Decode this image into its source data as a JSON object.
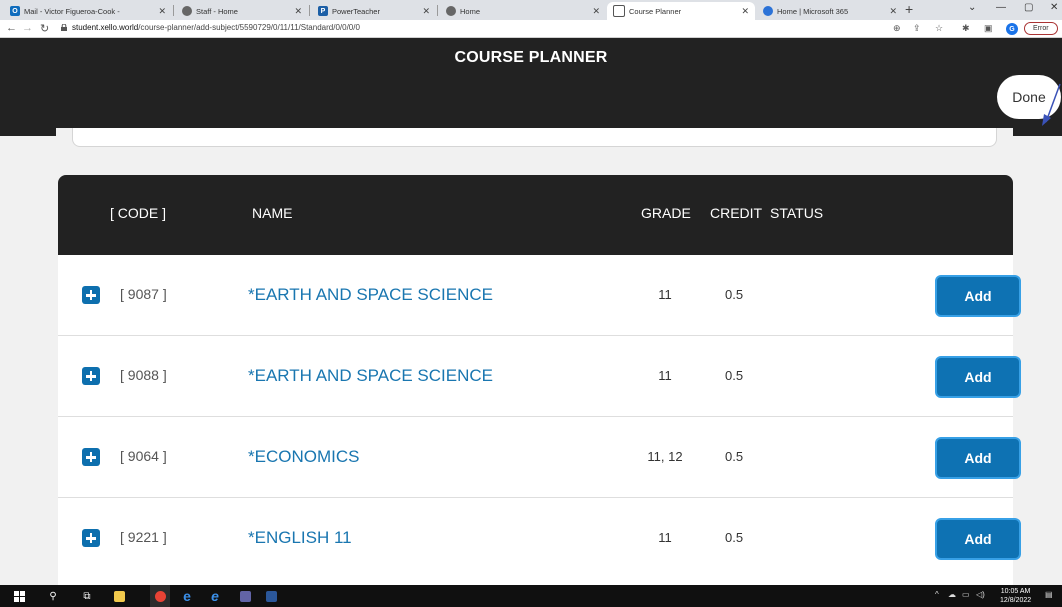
{
  "browser": {
    "tabs": [
      {
        "label": "Mail - Victor Figueroa-Cook -",
        "favicon": "outlook-icon",
        "color": "#0f6cbd"
      },
      {
        "label": "Staff - Home",
        "favicon": "globe-icon",
        "color": "#555555"
      },
      {
        "label": "PowerTeacher",
        "favicon": "powerteacher-icon",
        "color": "#1c5fa6"
      },
      {
        "label": "Home",
        "favicon": "globe-icon",
        "color": "#555555"
      },
      {
        "label": "Course Planner",
        "favicon": "xello-icon",
        "color": "#555555",
        "active": true
      },
      {
        "label": "Home | Microsoft 365",
        "favicon": "microsoft365-icon",
        "color": "#2b72d7"
      }
    ],
    "url_host": "student.xello.world",
    "url_path": "/course-planner/add-subject/5590729/0/11/11/Standard/0/0/0/0",
    "profile_initial": "G",
    "error_label": "Error"
  },
  "app": {
    "title": "COURSE PLANNER",
    "done_label": "Done"
  },
  "table": {
    "headers": {
      "code": "[ CODE ]",
      "name": "NAME",
      "grade": "GRADE",
      "credit": "CREDIT",
      "status": "STATUS"
    },
    "rows": [
      {
        "code": "[ 9087 ]",
        "name": "*EARTH AND SPACE SCIENCE",
        "grade": "11",
        "credit": "0.5",
        "status": "",
        "action": "Add"
      },
      {
        "code": "[ 9088 ]",
        "name": "*EARTH AND SPACE SCIENCE",
        "grade": "11",
        "credit": "0.5",
        "status": "",
        "action": "Add"
      },
      {
        "code": "[ 9064 ]",
        "name": "*ECONOMICS",
        "grade": "11, 12",
        "credit": "0.5",
        "status": "",
        "action": "Add"
      },
      {
        "code": "[ 9221 ]",
        "name": "*ENGLISH 11",
        "grade": "11",
        "credit": "0.5",
        "status": "",
        "action": "Add"
      }
    ]
  },
  "taskbar": {
    "time": "10:05 AM",
    "date": "12/8/2022"
  },
  "colors": {
    "header_bg": "#222222",
    "link_blue": "#1976b0",
    "button_blue": "#0e72b3"
  }
}
